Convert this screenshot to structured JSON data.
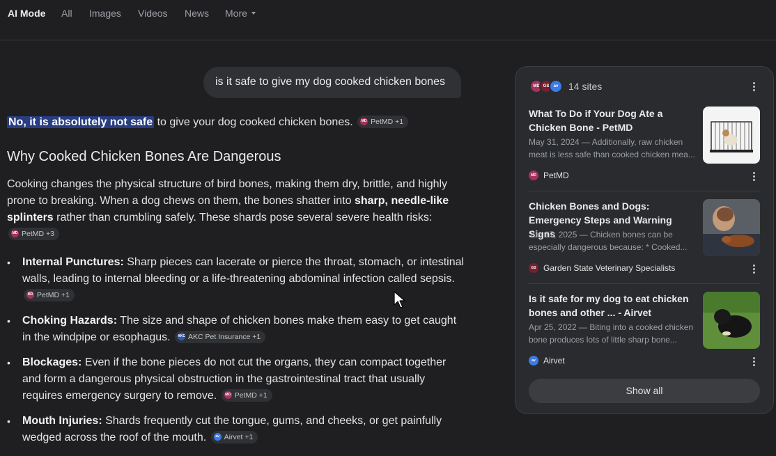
{
  "nav": {
    "tabs": [
      "AI Mode",
      "All",
      "Images",
      "Videos",
      "News",
      "More"
    ]
  },
  "query": "is it safe to give my dog cooked chicken bones",
  "answer": {
    "intro_highlight": "No, it is absolutely not safe",
    "intro_rest": " to give your dog cooked chicken bones.",
    "intro_chip": "PetMD +1",
    "heading": "Why Cooked Chicken Bones Are Dangerous",
    "para_1": "Cooking changes the physical structure of bird bones, making them dry, brittle, and highly prone to breaking. When a dog chews on them, the bones shatter into ",
    "para_bold": "sharp, needle-like splinters",
    "para_2": " rather than crumbling safely. These shards pose several severe health risks:",
    "para_chip": "PetMD +3",
    "bullets": [
      {
        "title": "Internal Punctures:",
        "text": " Sharp pieces can lacerate or pierce the throat, stomach, or intestinal walls, leading to internal bleeding or a life-threatening abdominal infection called sepsis.",
        "chip": "PetMD +1"
      },
      {
        "title": "Choking Hazards:",
        "text": " The size and shape of chicken bones make them easy to get caught in the windpipe or esophagus.",
        "chip": "AKC Pet Insurance +1"
      },
      {
        "title": "Blockages:",
        "text": " Even if the bone pieces do not cut the organs, they can compact together and form a dangerous physical obstruction in the gastrointestinal tract that usually requires emergency surgery to remove.",
        "chip": "PetMD +1"
      },
      {
        "title": "Mouth Injuries:",
        "text": " Shards frequently cut the tongue, gums, and cheeks, or get painfully wedged across the roof of the mouth.",
        "chip": "Airvet +1"
      }
    ]
  },
  "sources": {
    "count_label": "14 sites",
    "cards": [
      {
        "title": "What To Do if Your Dog Ate a Chicken Bone - PetMD",
        "snippet_1": "May 31, 2024 — Additionally, raw chicken",
        "snippet_2": "meat is less safe than cooked chicken mea...",
        "source": "PetMD",
        "icon": "petmd-icon"
      },
      {
        "title": "Chicken Bones and Dogs: Emergency Steps and Warning Signs",
        "snippet_1": "Jun 17, 2025 — Chicken bones can be",
        "snippet_2": "especially dangerous because: * Cooked...",
        "source": "Garden State Veterinary Specialists",
        "icon": "gsvs-icon"
      },
      {
        "title": "Is it safe for my dog to eat chicken bones and other ... - Airvet",
        "snippet_1": "Apr 25, 2022 — Biting into a cooked chicken",
        "snippet_2": "bone produces lots of little sharp bone...",
        "source": "Airvet",
        "icon": "airvet-icon"
      }
    ],
    "show_all": "Show all"
  },
  "colors": {
    "background": "#1f1f22",
    "panel": "#2a2b2e",
    "highlight": "#283d82",
    "chip": "#303134"
  }
}
